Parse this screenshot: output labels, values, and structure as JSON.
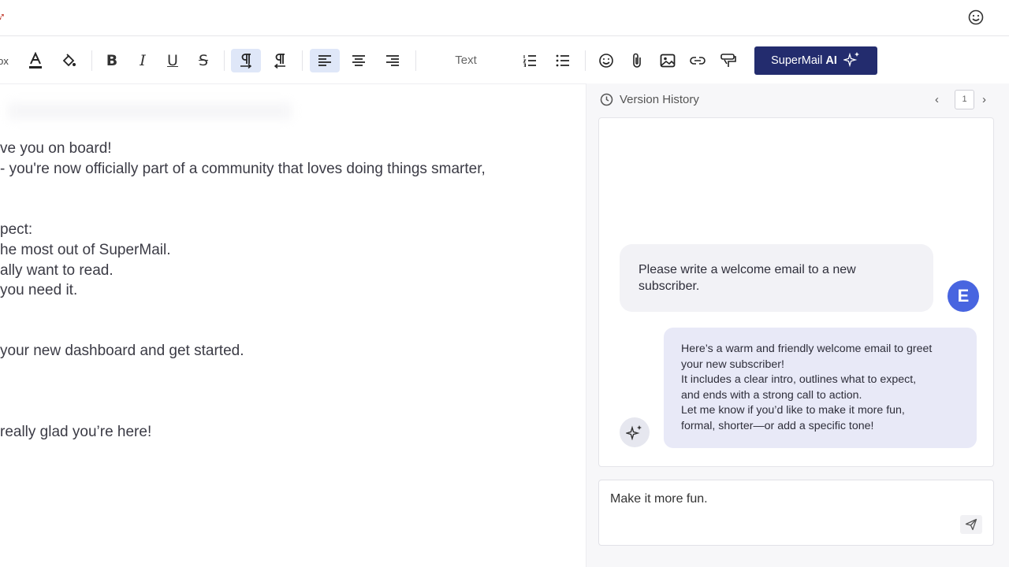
{
  "toolbar": {
    "cut_label": "ox",
    "text_style_label": "Text",
    "ai_button": {
      "label": "SuperMail",
      "label_bold": "AI"
    }
  },
  "editor": {
    "lines": [
      "ve you on board!",
      "- you're now officially part of a community that loves doing things smarter,",
      "pect:",
      "he most out of SuperMail.",
      "ally want to read.",
      "you need it.",
      "your new dashboard and get started.",
      "really glad you’re here!"
    ]
  },
  "version_history": {
    "title": "Version History",
    "page": "1"
  },
  "chat": {
    "user_message": "Please write a welcome email to a new subscriber.",
    "user_avatar_letter": "E",
    "ai_message_lines": [
      "Here’s a warm and friendly welcome email to greet",
      "your new subscriber!",
      "It includes a clear intro, outlines what to expect,",
      "and ends with a strong call to action.",
      "Let me know if you’d like to make it more fun,",
      "formal, shorter—or add a specific tone!"
    ],
    "input_value": "Make it more fun."
  },
  "colors": {
    "ai_button_bg": "#232c6e",
    "active_tool_bg": "#dfe7f8",
    "avatar_bg": "#4865e0",
    "ai_bubble_bg": "#e8e9f7"
  }
}
